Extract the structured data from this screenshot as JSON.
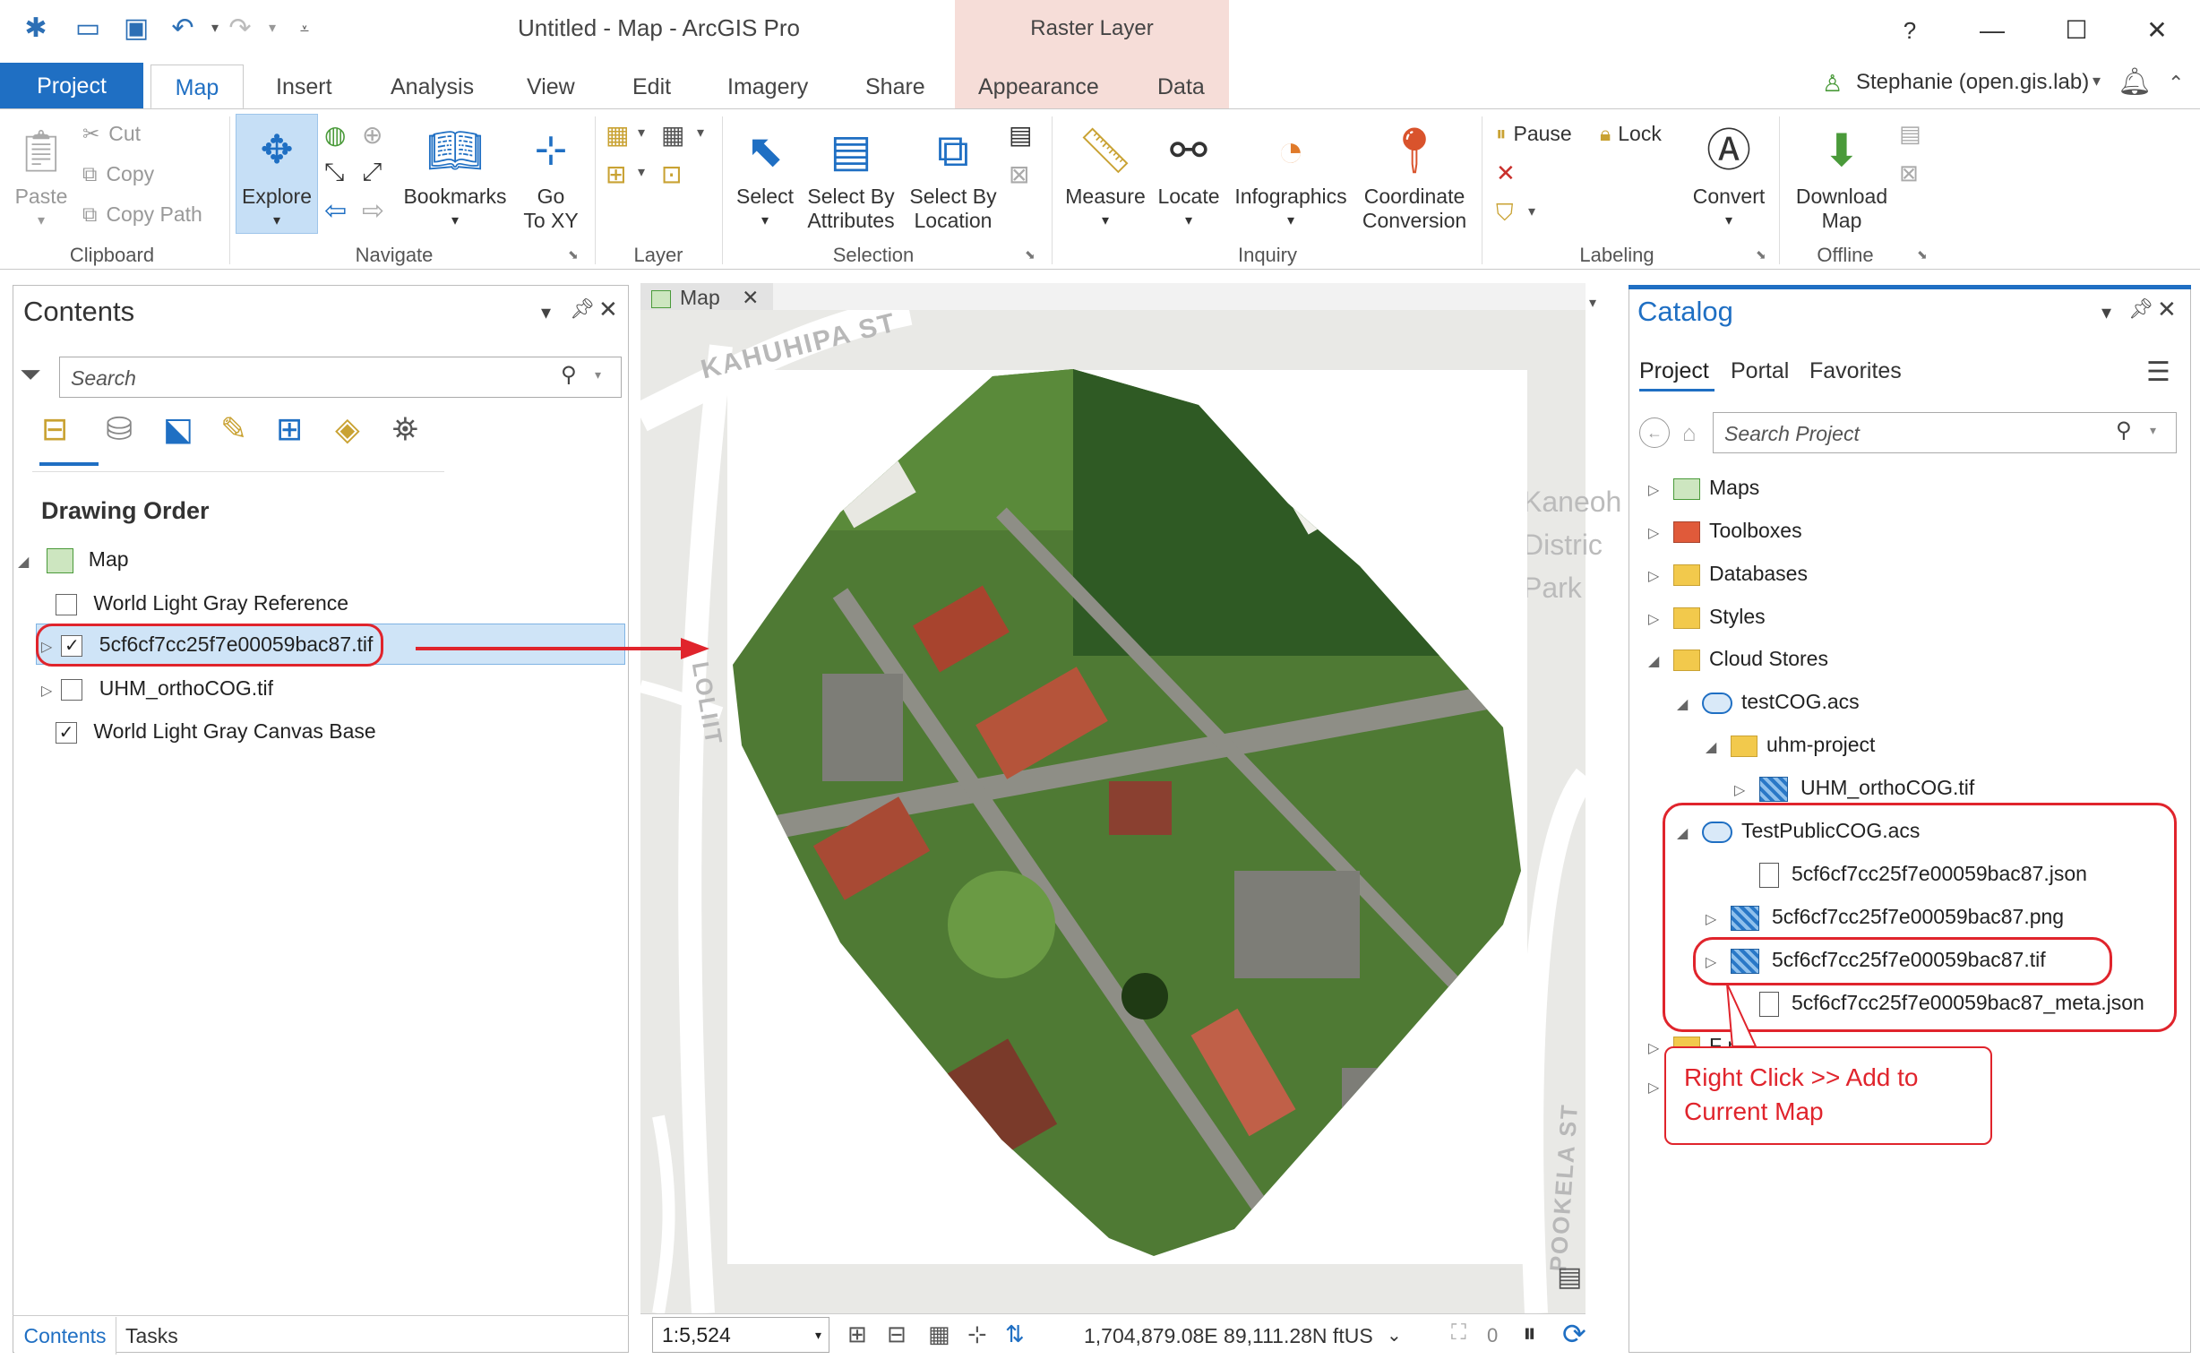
{
  "window": {
    "title": "Untitled - Map - ArcGIS Pro",
    "context_tab_group": "Raster Layer",
    "user": "Stephanie (open.gis.lab)",
    "help": "?"
  },
  "ribbon_tabs": [
    "Project",
    "Map",
    "Insert",
    "Analysis",
    "View",
    "Edit",
    "Imagery",
    "Share",
    "Appearance",
    "Data"
  ],
  "ribbon": {
    "clipboard": {
      "label": "Clipboard",
      "paste": "Paste",
      "cut": "Cut",
      "copy": "Copy",
      "copy_path": "Copy Path"
    },
    "navigate": {
      "label": "Navigate",
      "explore": "Explore",
      "bookmarks": "Bookmarks",
      "go_to_xy_1": "Go",
      "go_to_xy_2": "To XY"
    },
    "layer": {
      "label": "Layer"
    },
    "selection": {
      "label": "Selection",
      "select": "Select",
      "select_by_attr_1": "Select By",
      "select_by_attr_2": "Attributes",
      "select_by_loc_1": "Select By",
      "select_by_loc_2": "Location"
    },
    "inquiry": {
      "label": "Inquiry",
      "measure": "Measure",
      "locate": "Locate",
      "infographics": "Infographics",
      "coord_1": "Coordinate",
      "coord_2": "Conversion"
    },
    "labeling": {
      "label": "Labeling",
      "pause": "Pause",
      "lock": "Lock",
      "convert": "Convert"
    },
    "offline": {
      "label": "Offline",
      "download_1": "Download",
      "download_2": "Map"
    }
  },
  "contents": {
    "title": "Contents",
    "search_placeholder": "Search",
    "section": "Drawing Order",
    "map_node": "Map",
    "layers": [
      {
        "name": "World Light Gray Reference",
        "checked": false
      },
      {
        "name": "5cf6cf7cc25f7e00059bac87.tif",
        "checked": true
      },
      {
        "name": "UHM_orthoCOG.tif",
        "checked": false
      },
      {
        "name": "World Light Gray Canvas Base",
        "checked": true
      }
    ],
    "bottom_tabs": [
      "Contents",
      "Tasks"
    ]
  },
  "map_view": {
    "tab_label": "Map",
    "street_labels": [
      "KAHUHIPA ST",
      "LOLIIT",
      "POOKELA ST"
    ],
    "park_label": [
      "Kaneoh",
      "Distric",
      "Park"
    ],
    "scale": "1:5,524",
    "coordinates": "1,704,879.08E 89,111.28N ftUS",
    "selected_count": "0"
  },
  "catalog": {
    "title": "Catalog",
    "tabs": [
      "Project",
      "Portal",
      "Favorites"
    ],
    "search_placeholder": "Search Project",
    "items": {
      "maps": "Maps",
      "toolboxes": "Toolboxes",
      "databases": "Databases",
      "styles": "Styles",
      "cloud_stores": "Cloud Stores",
      "testcog": "testCOG.acs",
      "uhm_project": "uhm-project",
      "uhm_ortho": "UHM_orthoCOG.tif",
      "testpublic": "TestPublicCOG.acs",
      "json": "5cf6cf7cc25f7e00059bac87.json",
      "png": "5cf6cf7cc25f7e00059bac87.png",
      "tif": "5cf6cf7cc25f7e00059bac87.tif",
      "meta": "5cf6cf7cc25f7e00059bac87_meta.json",
      "folders_partial": "F         rs"
    }
  },
  "annotation": {
    "callout_line1": "Right Click >> Add to",
    "callout_line2": "Current Map",
    "color": "#e0242c"
  },
  "colors": {
    "accent": "#1f6fc3",
    "context_tab": "#f6ddd8"
  }
}
